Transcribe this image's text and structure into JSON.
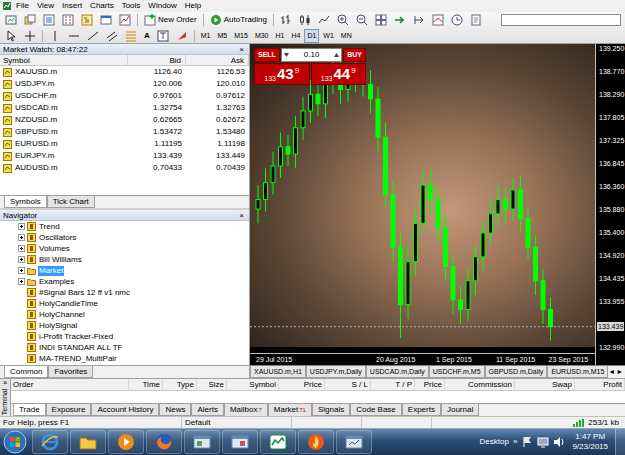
{
  "menu": {
    "items": [
      "File",
      "View",
      "Insert",
      "Charts",
      "Tools",
      "Window",
      "Help"
    ]
  },
  "toolbar": {
    "new_order": "New Order",
    "autotrading": "AutoTrading",
    "text_tool": "A",
    "timeframes": [
      {
        "label": "M1",
        "selected": false
      },
      {
        "label": "M5",
        "selected": false
      },
      {
        "label": "M15",
        "selected": false
      },
      {
        "label": "M30",
        "selected": false
      },
      {
        "label": "H1",
        "selected": false
      },
      {
        "label": "H4",
        "selected": false
      },
      {
        "label": "D1",
        "selected": true
      },
      {
        "label": "W1",
        "selected": false
      },
      {
        "label": "MN",
        "selected": false
      }
    ]
  },
  "market_watch": {
    "title": "Market Watch: 08:47:22",
    "close": "×",
    "columns": [
      "Symbol",
      "Bid",
      "Ask"
    ],
    "rows": [
      [
        "XAUUSD.m",
        "1126.40",
        "1126.53"
      ],
      [
        "USDJPY.m",
        "120.006",
        "120.010"
      ],
      [
        "USDCHF.m",
        "0.97601",
        "0.97612"
      ],
      [
        "USDCAD.m",
        "1.32754",
        "1.32763"
      ],
      [
        "NZDUSD.m",
        "0.62665",
        "0.62672"
      ],
      [
        "GBPUSD.m",
        "1.53472",
        "1.53480"
      ],
      [
        "EURUSD.m",
        "1.11195",
        "1.11198"
      ],
      [
        "EURJPY.m",
        "133.439",
        "133.449"
      ],
      [
        "AUDUSD.m",
        "0.70433",
        "0.70439"
      ]
    ],
    "tabs": [
      {
        "label": "Symbols",
        "selected": true
      },
      {
        "label": "Tick Chart",
        "selected": false
      }
    ]
  },
  "navigator": {
    "title": "Navigator",
    "close": "×",
    "items": [
      {
        "label": "Trend",
        "kind": "category",
        "expanded": false,
        "selected": false
      },
      {
        "label": "Oscillators",
        "kind": "category",
        "expanded": false,
        "selected": false
      },
      {
        "label": "Volumes",
        "kind": "category",
        "expanded": false,
        "selected": false
      },
      {
        "label": "Bill Williams",
        "kind": "category",
        "expanded": false,
        "selected": false
      },
      {
        "label": "Market",
        "kind": "folder",
        "expanded": false,
        "selected": true
      },
      {
        "label": "Examples",
        "kind": "folder",
        "expanded": false,
        "selected": false
      },
      {
        "label": "#Signal Bars 12 ff v1 nmc",
        "kind": "indicator",
        "selected": false
      },
      {
        "label": "HolyCandleTime",
        "kind": "indicator",
        "selected": false
      },
      {
        "label": "HolyChannel",
        "kind": "indicator",
        "selected": false
      },
      {
        "label": "HolySignal",
        "kind": "indicator",
        "selected": false
      },
      {
        "label": "i-Profit Tracker-Fixed",
        "kind": "indicator",
        "selected": false
      },
      {
        "label": "INDI STANDAR ALL TF",
        "kind": "indicator",
        "selected": false
      },
      {
        "label": "MA-TREND_MultiPair",
        "kind": "indicator",
        "selected": false
      }
    ],
    "tabs": [
      {
        "label": "Common",
        "selected": true
      },
      {
        "label": "Favorites",
        "selected": false
      }
    ]
  },
  "trade_panel": {
    "sell": "SELL",
    "buy": "BUY",
    "lots": "0.10",
    "sell_quote": {
      "big_figure": "133",
      "pips": "43",
      "point": "9"
    },
    "buy_quote": {
      "big_figure": "133",
      "pips": "44",
      "point": "9"
    }
  },
  "chart": {
    "price_ticks": [
      {
        "label": "139.250",
        "value": 139.25
      },
      {
        "label": "138.770",
        "value": 138.77
      },
      {
        "label": "138.290",
        "value": 138.29
      },
      {
        "label": "137.805",
        "value": 137.805
      },
      {
        "label": "137.325",
        "value": 137.325
      },
      {
        "label": "136.845",
        "value": 136.845
      },
      {
        "label": "136.360",
        "value": 136.36
      },
      {
        "label": "135.880",
        "value": 135.88
      },
      {
        "label": "135.400",
        "value": 135.4
      },
      {
        "label": "134.920",
        "value": 134.92
      },
      {
        "label": "134.435",
        "value": 134.435
      },
      {
        "label": "133.955",
        "value": 133.955
      },
      {
        "label": "132.990",
        "value": 132.99
      }
    ],
    "bid": {
      "label": "133.439",
      "value": 133.439
    },
    "date_ticks": [
      {
        "label": "29 Jul 2015",
        "bar": 0
      },
      {
        "label": "20 Aug 2015",
        "bar": 16
      },
      {
        "label": "1 Sep 2015",
        "bar": 24
      },
      {
        "label": "11 Sep 2015",
        "bar": 32
      },
      {
        "label": "23 Sep 2015",
        "bar": 39
      }
    ],
    "series": {
      "open": [
        135.9,
        136.1,
        136.45,
        136.8,
        137.2,
        137.05,
        137.6,
        137.95,
        138.3,
        138.1,
        138.55,
        138.85,
        138.4,
        138.6,
        138.75,
        138.5,
        138.2,
        137.4,
        136.2,
        135.1,
        133.9,
        134.8,
        135.6,
        136.4,
        136.1,
        135.5,
        134.7,
        134.0,
        133.8,
        134.4,
        134.9,
        135.4,
        135.8,
        136.1,
        135.9,
        136.3,
        135.7,
        135.1,
        134.4,
        133.8
      ],
      "high": [
        136.4,
        136.75,
        137.1,
        137.5,
        137.45,
        137.85,
        138.25,
        138.6,
        138.55,
        138.85,
        139.1,
        139.05,
        138.9,
        139.0,
        138.95,
        138.8,
        138.45,
        137.7,
        136.5,
        135.4,
        135.1,
        135.9,
        136.7,
        136.75,
        136.35,
        135.8,
        134.95,
        134.3,
        134.65,
        135.15,
        135.65,
        136.1,
        136.4,
        136.35,
        136.55,
        136.6,
        135.95,
        135.35,
        134.65,
        134.05
      ],
      "low": [
        135.6,
        135.85,
        136.2,
        136.55,
        136.8,
        136.75,
        137.35,
        137.7,
        137.85,
        137.8,
        138.3,
        138.1,
        138.15,
        138.35,
        138.25,
        137.9,
        137.1,
        135.9,
        134.8,
        133.2,
        133.6,
        134.5,
        135.35,
        135.8,
        135.2,
        134.4,
        133.7,
        133.5,
        133.55,
        134.1,
        134.6,
        135.15,
        135.55,
        135.6,
        135.65,
        135.4,
        134.85,
        134.1,
        133.5,
        133.15
      ],
      "close": [
        136.1,
        136.45,
        136.8,
        137.2,
        137.05,
        137.6,
        137.95,
        138.3,
        138.1,
        138.55,
        138.85,
        138.4,
        138.6,
        138.75,
        138.5,
        138.2,
        137.4,
        136.2,
        135.1,
        133.9,
        134.8,
        135.6,
        136.4,
        136.1,
        135.5,
        134.7,
        134.0,
        133.8,
        134.4,
        134.9,
        135.4,
        135.8,
        136.1,
        135.9,
        136.3,
        135.7,
        135.1,
        134.4,
        133.8,
        133.44
      ]
    }
  },
  "chart_tabs": {
    "tabs": [
      {
        "label": "XAUUSD.m,H1",
        "selected": false
      },
      {
        "label": "USDJPY.m,Daily",
        "selected": false
      },
      {
        "label": "USDCAD.m,Daily",
        "selected": false
      },
      {
        "label": "USDCHF.m,M5",
        "selected": false
      },
      {
        "label": "GBPUSD.m,Daily",
        "selected": false
      },
      {
        "label": "EURUSD.m,M15",
        "selected": false
      }
    ],
    "scroll_left": "◄",
    "scroll_right": "►"
  },
  "terminal": {
    "label": "Terminal",
    "close": "×",
    "columns": [
      "Order",
      "Time",
      "Type",
      "Size",
      "Symbol",
      "Price",
      "S / L",
      "T / P",
      "Price",
      "Commission",
      "Swap",
      "Profit"
    ],
    "tabs": [
      {
        "label": "Trade",
        "selected": true
      },
      {
        "label": "Exposure",
        "selected": false
      },
      {
        "label": "Account History",
        "selected": false
      },
      {
        "label": "News",
        "selected": false
      },
      {
        "label": "Alerts",
        "selected": false
      },
      {
        "label": "Mailbox",
        "badge": "7",
        "selected": false
      },
      {
        "label": "Market",
        "badge": "71",
        "selected": false
      },
      {
        "label": "Signals",
        "selected": false
      },
      {
        "label": "Code Base",
        "selected": false
      },
      {
        "label": "Experts",
        "selected": false
      },
      {
        "label": "Journal",
        "selected": false
      }
    ]
  },
  "status_bar": {
    "help": "For Help, press F1",
    "profile": "Default",
    "traffic": "253/1 kb"
  },
  "taskbar": {
    "desktop": "Desktop",
    "more": "»",
    "time": "1:47 PM",
    "date": "9/23/2015"
  }
}
